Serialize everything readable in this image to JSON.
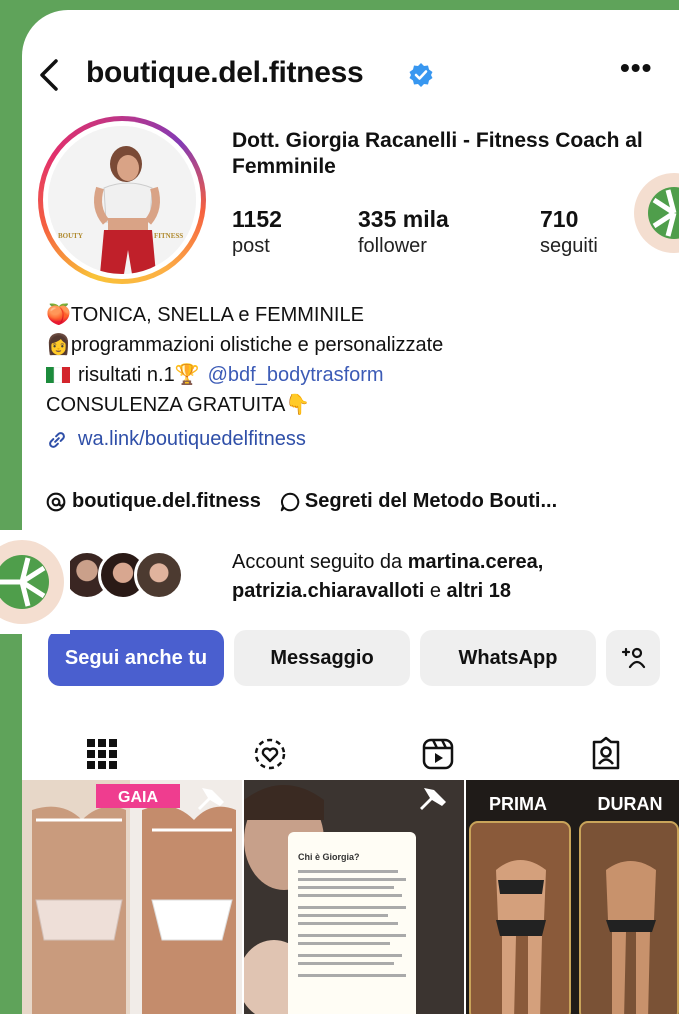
{
  "header": {
    "username": "boutique.del.fitness",
    "back_icon": "chevron-left-icon",
    "verified_icon": "verified-badge-icon",
    "more_label": "•••"
  },
  "profile": {
    "avatar_text_left": "BOUTY",
    "avatar_text_right": "FITNESS",
    "display_name": "Dott. Giorgia Racanelli - Fitness Coach al Femminile",
    "stats": [
      {
        "value": "1152",
        "label": "post"
      },
      {
        "value": "335 mila",
        "label": "follower"
      },
      {
        "value": "710",
        "label": "seguiti"
      }
    ]
  },
  "bio": {
    "line1_emoji": "🍑",
    "line1": "TONICA, SNELLA e FEMMINILE",
    "line2_emoji": "👩",
    "line2": "programmazioni olistiche e personalizzate",
    "line3_flag": "italy-flag-icon",
    "line3": "risultati n.1",
    "line3_emoji": "🏆",
    "line3_mention": "@bdf_bodytrasform",
    "line4": "CONSULENZA GRATUITA",
    "line4_emoji": "👇"
  },
  "link": {
    "icon": "link-icon",
    "text": "wa.link/boutiquedelfitness"
  },
  "threads": {
    "threads_label": "boutique.del.fitness",
    "channel_label": "Segreti del Metodo Bouti..."
  },
  "followed_by": {
    "prefix": "Account seguito da ",
    "user1": "martina.cerea,",
    "user2": "patrizia.chiaravalloti",
    "middle": " e ",
    "rest": "altri 18"
  },
  "actions": {
    "follow": "Segui anche tu",
    "message": "Messaggio",
    "whatsapp": "WhatsApp",
    "add_user_icon": "add-user-icon"
  },
  "tabs": [
    "grid-icon",
    "tagged-heart-icon",
    "reels-icon",
    "tagged-profile-icon"
  ],
  "posts": [
    {
      "label": "GAIA",
      "pinned": true
    },
    {
      "label": "",
      "pinned": true,
      "doc_title": "Chi è Giorgia?"
    },
    {
      "label_left": "PRIMA",
      "label_right": "DURAN"
    }
  ],
  "colors": {
    "background": "#5fa35a",
    "primary_button": "#4a5fcf",
    "link": "#3c5bb6",
    "verified": "#3897f0"
  }
}
